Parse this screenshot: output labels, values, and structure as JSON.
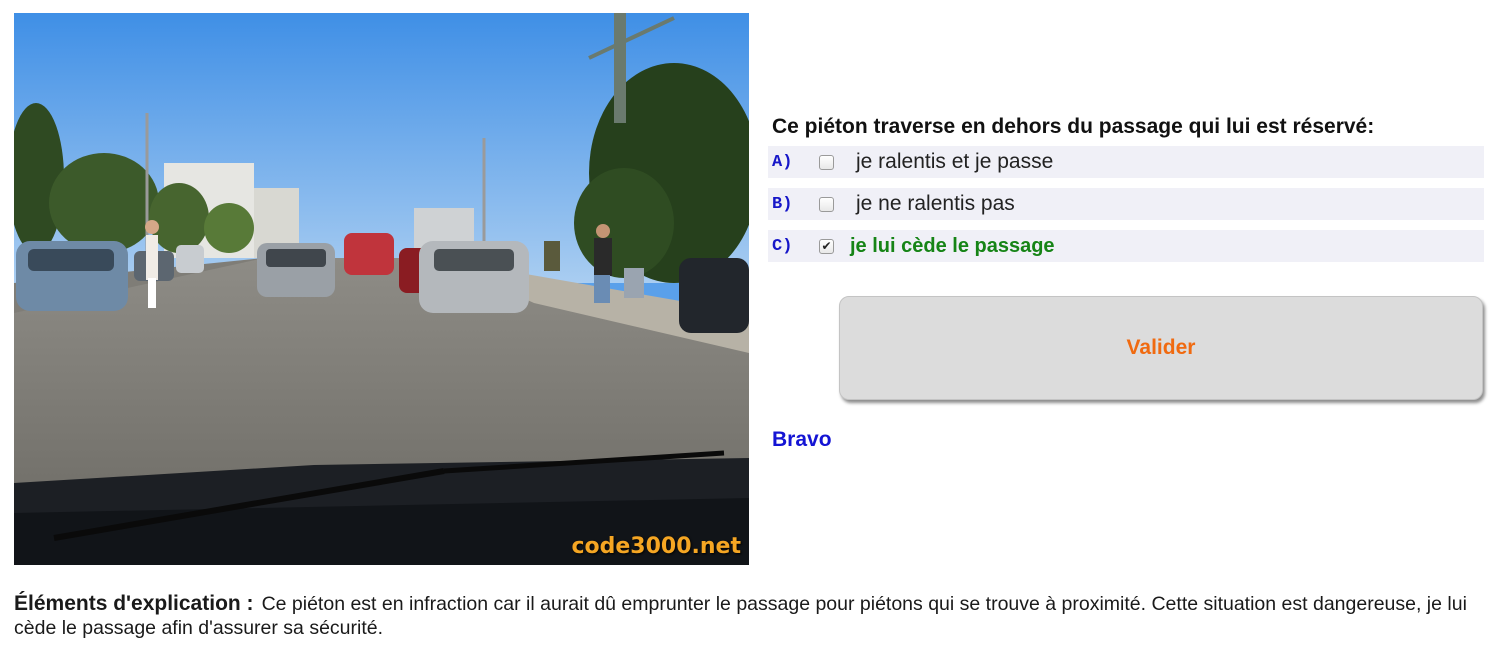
{
  "photo": {
    "alt_scene": "road-pedestrian-scene",
    "watermark": "code3000.net",
    "watermark_color": "#f5a623"
  },
  "question": {
    "text": "Ce piéton traverse en dehors du passage qui lui est réservé:"
  },
  "answers": [
    {
      "letter": "A)",
      "text": "je ralentis et je passe",
      "checked": false
    },
    {
      "letter": "B)",
      "text": "je ne ralentis pas",
      "checked": false
    },
    {
      "letter": "C)",
      "text": "je lui cède le passage",
      "checked": true
    }
  ],
  "validate_button": {
    "label": "Valider",
    "color": "#f06a10"
  },
  "feedback": {
    "text": "Bravo",
    "color": "#1414d4"
  },
  "explanation": {
    "label": "Éléments d'explication :",
    "text": "Ce piéton est en infraction car il aurait dû emprunter le passage pour piétons qui se trouve à proximité. Cette situation est dangereuse, je lui cède le passage afin d'assurer sa sécurité."
  },
  "colors": {
    "letter": "#1616c8",
    "correct_answer": "#168416",
    "answer_row_bg": "#f0f0f7"
  }
}
